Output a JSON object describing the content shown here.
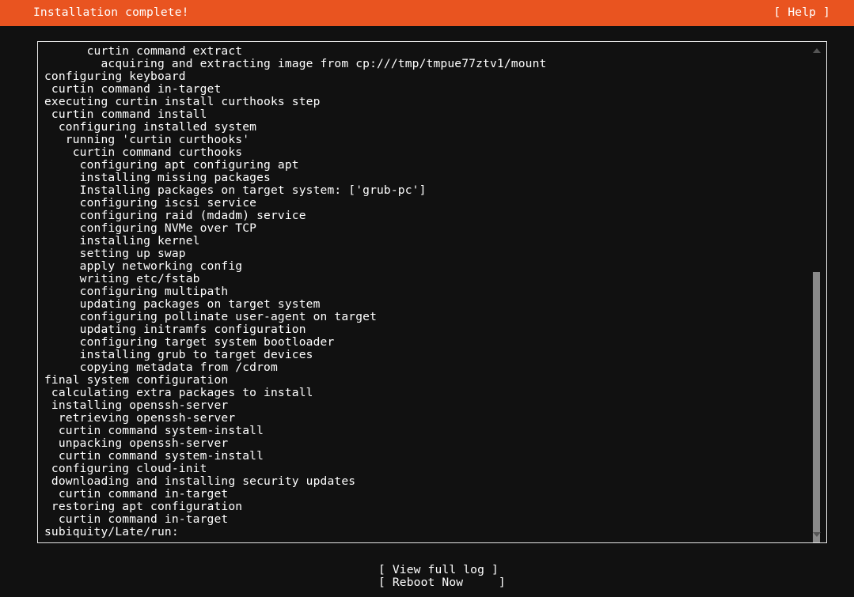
{
  "header": {
    "title": "Installation complete!",
    "help_label": "[ Help ]",
    "background_color": "#e95420",
    "text_color": "#ffffff"
  },
  "colors": {
    "screen_background": "#111111",
    "accent_orange": "#e95420",
    "panel_border": "#e6e6e6",
    "scrollbar_thumb": "#8a8a8a",
    "scrollbar_arrow": "#555555",
    "log_text": "#ffffff"
  },
  "log": {
    "lines": [
      "      curtin command extract",
      "        acquiring and extracting image from cp:///tmp/tmpue77ztv1/mount",
      "configuring keyboard",
      " curtin command in-target",
      "executing curtin install curthooks step",
      " curtin command install",
      "  configuring installed system",
      "   running 'curtin curthooks'",
      "    curtin command curthooks",
      "     configuring apt configuring apt",
      "     installing missing packages",
      "     Installing packages on target system: ['grub-pc']",
      "     configuring iscsi service",
      "     configuring raid (mdadm) service",
      "     configuring NVMe over TCP",
      "     installing kernel",
      "     setting up swap",
      "     apply networking config",
      "     writing etc/fstab",
      "     configuring multipath",
      "     updating packages on target system",
      "     configuring pollinate user-agent on target",
      "     updating initramfs configuration",
      "     configuring target system bootloader",
      "     installing grub to target devices",
      "     copying metadata from /cdrom",
      "final system configuration",
      " calculating extra packages to install",
      " installing openssh-server",
      "  retrieving openssh-server",
      "  curtin command system-install",
      "  unpacking openssh-server",
      "  curtin command system-install",
      " configuring cloud-init",
      " downloading and installing security updates",
      "  curtin command in-target",
      " restoring apt configuration",
      "  curtin command in-target",
      "subiquity/Late/run:"
    ]
  },
  "scrollbar": {
    "up_arrow": "scroll-up",
    "down_arrow": "scroll-down"
  },
  "footer": {
    "buttons": [
      {
        "label": "[ View full log ]",
        "name": "view-full-log-button"
      },
      {
        "label": "[ Reboot Now     ]",
        "name": "reboot-now-button"
      }
    ]
  }
}
